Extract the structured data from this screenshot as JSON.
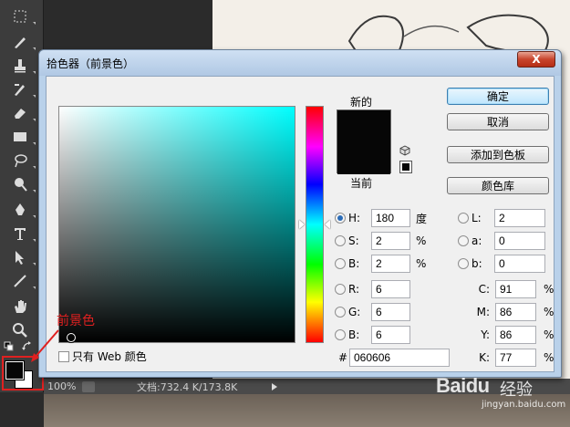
{
  "dialog": {
    "title": "拾色器（前景色）",
    "close_label": "X"
  },
  "buttons": {
    "ok": "确定",
    "cancel": "取消",
    "add_to_swatches": "添加到色板",
    "color_libraries": "颜色库"
  },
  "preview": {
    "new_label": "新的",
    "current_label": "当前",
    "new_color": "#060606",
    "current_color": "#060606"
  },
  "hsb": {
    "h": {
      "label": "H:",
      "value": "180",
      "unit": "度",
      "selected": true
    },
    "s": {
      "label": "S:",
      "value": "2",
      "unit": "%"
    },
    "b": {
      "label": "B:",
      "value": "2",
      "unit": "%"
    }
  },
  "rgb": {
    "r": {
      "label": "R:",
      "value": "6"
    },
    "g": {
      "label": "G:",
      "value": "6"
    },
    "b": {
      "label": "B:",
      "value": "6"
    }
  },
  "lab": {
    "l": {
      "label": "L:",
      "value": "2"
    },
    "a": {
      "label": "a:",
      "value": "0"
    },
    "b": {
      "label": "b:",
      "value": "0"
    }
  },
  "cmyk": {
    "c": {
      "label": "C:",
      "value": "91",
      "unit": "%"
    },
    "m": {
      "label": "M:",
      "value": "86",
      "unit": "%"
    },
    "y": {
      "label": "Y:",
      "value": "86",
      "unit": "%"
    },
    "k": {
      "label": "K:",
      "value": "77",
      "unit": "%"
    }
  },
  "hex": {
    "label": "#",
    "value": "060606"
  },
  "web_only": {
    "label": "只有 Web 颜色",
    "checked": false
  },
  "annotation": {
    "label": "前景色",
    "color": "#e02020"
  },
  "status": {
    "zoom": "100%",
    "doc_info": "文档:732.4 K/173.8K"
  },
  "watermark": {
    "brand": "Baidu",
    "product": "经验",
    "url": "jingyan.baidu.com"
  },
  "toolbar": {
    "tools": [
      "marquee-icon",
      "brush-icon",
      "stamp-icon",
      "history-brush-icon",
      "eraser-icon",
      "rectangle-icon",
      "lasso-icon",
      "dodge-icon",
      "pen-icon",
      "type-icon",
      "path-select-icon",
      "line-icon",
      "hand-icon",
      "zoom-icon"
    ]
  }
}
